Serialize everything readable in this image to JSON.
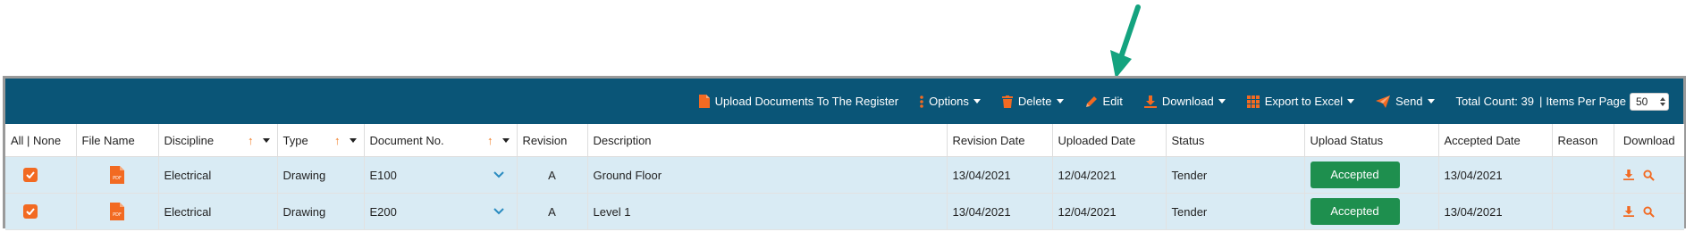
{
  "toolbar": {
    "upload_label": "Upload Documents To The Register",
    "options_label": "Options",
    "delete_label": "Delete",
    "edit_label": "Edit",
    "download_label": "Download",
    "export_label": "Export to Excel",
    "send_label": "Send",
    "total_count": "Total Count: 39",
    "separator": "|",
    "items_per_page_label": "Items Per Page",
    "items_per_page_value": "50"
  },
  "table": {
    "headers": {
      "select": "All | None",
      "file_name": "File Name",
      "discipline": "Discipline",
      "type": "Type",
      "document_no": "Document No.",
      "revision": "Revision",
      "description": "Description",
      "revision_date": "Revision Date",
      "uploaded_date": "Uploaded Date",
      "status": "Status",
      "upload_status": "Upload Status",
      "accepted_date": "Accepted Date",
      "reason": "Reason",
      "download": "Download"
    },
    "rows": [
      {
        "discipline": "Electrical",
        "type": "Drawing",
        "document_no": "E100",
        "revision": "A",
        "description": "Ground Floor",
        "revision_date": "13/04/2021",
        "uploaded_date": "12/04/2021",
        "status": "Tender",
        "upload_status": "Accepted",
        "accepted_date": "13/04/2021",
        "reason": ""
      },
      {
        "discipline": "Electrical",
        "type": "Drawing",
        "document_no": "E200",
        "revision": "A",
        "description": "Level 1",
        "revision_date": "13/04/2021",
        "uploaded_date": "12/04/2021",
        "status": "Tender",
        "upload_status": "Accepted",
        "accepted_date": "13/04/2021",
        "reason": ""
      }
    ]
  },
  "colors": {
    "toolbar_bg": "#0a5577",
    "accent_orange": "#f26a22",
    "row_bg": "#d9ebf4",
    "accepted_green": "#1e8f4e",
    "annotation_arrow": "#14a37f"
  },
  "icons": {
    "upload": "file-icon",
    "options": "vertical-dots-icon",
    "delete": "trash-icon",
    "edit": "pencil-icon",
    "download": "download-icon",
    "export": "grid-icon",
    "send": "paper-plane-icon",
    "file": "pdf-icon",
    "row_download": "download-icon",
    "row_view": "search-icon",
    "expand": "chevron-down-icon"
  }
}
